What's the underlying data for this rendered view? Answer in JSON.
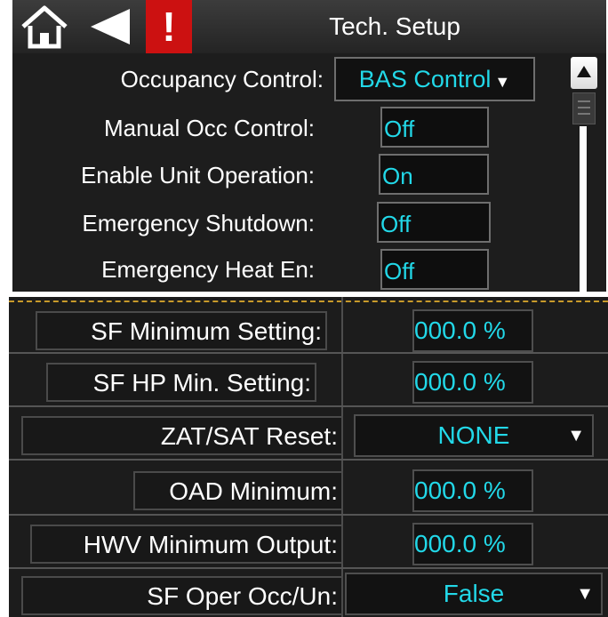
{
  "header": {
    "title": "Tech. Setup",
    "icons": [
      "home-icon",
      "back-arrow-icon",
      "alarm-exclamation-icon"
    ],
    "alarm_symbol": "!",
    "alarm_color": "#cc1111"
  },
  "top_settings": {
    "occupancy_control": {
      "label": "Occupancy Control:",
      "value": "BAS Control"
    },
    "rows": [
      {
        "label": "Manual Occ Control:",
        "value": "Off"
      },
      {
        "label": "Enable Unit Operation:",
        "value": "On"
      },
      {
        "label": "Emergency Shutdown:",
        "value": "Off"
      },
      {
        "label": "Emergency Heat En:",
        "value": "Off"
      }
    ]
  },
  "bottom_settings": {
    "rows": [
      {
        "label": "SF Minimum Setting:",
        "value": "000.0 %"
      },
      {
        "label": "SF HP Min. Setting:",
        "value": "000.0 %"
      },
      {
        "label": "ZAT/SAT Reset:",
        "value": "NONE"
      },
      {
        "label": "OAD Minimum:",
        "value": "000.0 %"
      },
      {
        "label": "HWV Minimum Output:",
        "value": "000.0 %"
      },
      {
        "label": "SF Oper Occ/Un:",
        "value": "False"
      }
    ]
  },
  "colors": {
    "value_text": "#22d8e8",
    "panel_bg": "#1d1d1d",
    "header_bg": "#2e2e2e",
    "divider_dash": "#c89a2a"
  },
  "caret_symbol": "▼"
}
